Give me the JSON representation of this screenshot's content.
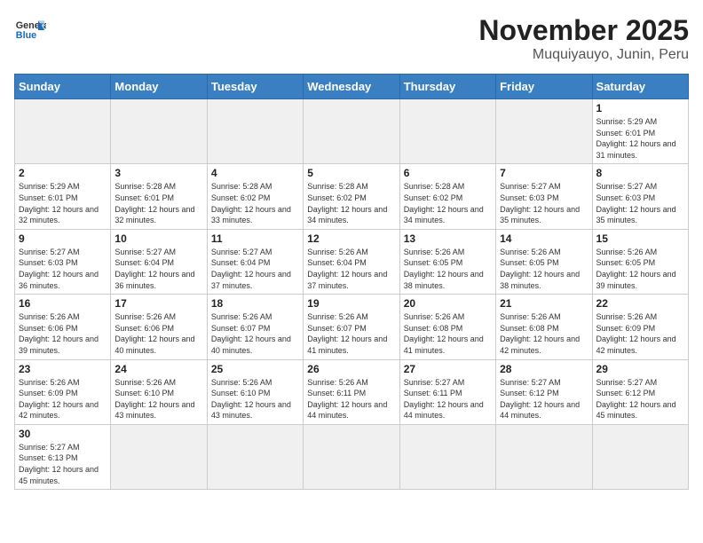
{
  "header": {
    "logo_text_normal": "General",
    "logo_text_blue": "Blue",
    "title": "November 2025",
    "subtitle": "Muquiyauyo, Junin, Peru"
  },
  "weekdays": [
    "Sunday",
    "Monday",
    "Tuesday",
    "Wednesday",
    "Thursday",
    "Friday",
    "Saturday"
  ],
  "days": [
    {
      "date": "",
      "empty": true
    },
    {
      "date": "",
      "empty": true
    },
    {
      "date": "",
      "empty": true
    },
    {
      "date": "",
      "empty": true
    },
    {
      "date": "",
      "empty": true
    },
    {
      "date": "",
      "empty": true
    },
    {
      "num": "1",
      "rise": "5:29 AM",
      "set": "6:01 PM",
      "daylight": "12 hours and 31 minutes."
    },
    {
      "num": "2",
      "rise": "5:29 AM",
      "set": "6:01 PM",
      "daylight": "12 hours and 32 minutes."
    },
    {
      "num": "3",
      "rise": "5:28 AM",
      "set": "6:01 PM",
      "daylight": "12 hours and 32 minutes."
    },
    {
      "num": "4",
      "rise": "5:28 AM",
      "set": "6:02 PM",
      "daylight": "12 hours and 33 minutes."
    },
    {
      "num": "5",
      "rise": "5:28 AM",
      "set": "6:02 PM",
      "daylight": "12 hours and 34 minutes."
    },
    {
      "num": "6",
      "rise": "5:28 AM",
      "set": "6:02 PM",
      "daylight": "12 hours and 34 minutes."
    },
    {
      "num": "7",
      "rise": "5:27 AM",
      "set": "6:03 PM",
      "daylight": "12 hours and 35 minutes."
    },
    {
      "num": "8",
      "rise": "5:27 AM",
      "set": "6:03 PM",
      "daylight": "12 hours and 35 minutes."
    },
    {
      "num": "9",
      "rise": "5:27 AM",
      "set": "6:03 PM",
      "daylight": "12 hours and 36 minutes."
    },
    {
      "num": "10",
      "rise": "5:27 AM",
      "set": "6:04 PM",
      "daylight": "12 hours and 36 minutes."
    },
    {
      "num": "11",
      "rise": "5:27 AM",
      "set": "6:04 PM",
      "daylight": "12 hours and 37 minutes."
    },
    {
      "num": "12",
      "rise": "5:26 AM",
      "set": "6:04 PM",
      "daylight": "12 hours and 37 minutes."
    },
    {
      "num": "13",
      "rise": "5:26 AM",
      "set": "6:05 PM",
      "daylight": "12 hours and 38 minutes."
    },
    {
      "num": "14",
      "rise": "5:26 AM",
      "set": "6:05 PM",
      "daylight": "12 hours and 38 minutes."
    },
    {
      "num": "15",
      "rise": "5:26 AM",
      "set": "6:05 PM",
      "daylight": "12 hours and 39 minutes."
    },
    {
      "num": "16",
      "rise": "5:26 AM",
      "set": "6:06 PM",
      "daylight": "12 hours and 39 minutes."
    },
    {
      "num": "17",
      "rise": "5:26 AM",
      "set": "6:06 PM",
      "daylight": "12 hours and 40 minutes."
    },
    {
      "num": "18",
      "rise": "5:26 AM",
      "set": "6:07 PM",
      "daylight": "12 hours and 40 minutes."
    },
    {
      "num": "19",
      "rise": "5:26 AM",
      "set": "6:07 PM",
      "daylight": "12 hours and 41 minutes."
    },
    {
      "num": "20",
      "rise": "5:26 AM",
      "set": "6:08 PM",
      "daylight": "12 hours and 41 minutes."
    },
    {
      "num": "21",
      "rise": "5:26 AM",
      "set": "6:08 PM",
      "daylight": "12 hours and 42 minutes."
    },
    {
      "num": "22",
      "rise": "5:26 AM",
      "set": "6:09 PM",
      "daylight": "12 hours and 42 minutes."
    },
    {
      "num": "23",
      "rise": "5:26 AM",
      "set": "6:09 PM",
      "daylight": "12 hours and 42 minutes."
    },
    {
      "num": "24",
      "rise": "5:26 AM",
      "set": "6:10 PM",
      "daylight": "12 hours and 43 minutes."
    },
    {
      "num": "25",
      "rise": "5:26 AM",
      "set": "6:10 PM",
      "daylight": "12 hours and 43 minutes."
    },
    {
      "num": "26",
      "rise": "5:26 AM",
      "set": "6:11 PM",
      "daylight": "12 hours and 44 minutes."
    },
    {
      "num": "27",
      "rise": "5:27 AM",
      "set": "6:11 PM",
      "daylight": "12 hours and 44 minutes."
    },
    {
      "num": "28",
      "rise": "5:27 AM",
      "set": "6:12 PM",
      "daylight": "12 hours and 44 minutes."
    },
    {
      "num": "29",
      "rise": "5:27 AM",
      "set": "6:12 PM",
      "daylight": "12 hours and 45 minutes."
    },
    {
      "num": "30",
      "rise": "5:27 AM",
      "set": "6:13 PM",
      "daylight": "12 hours and 45 minutes."
    }
  ]
}
